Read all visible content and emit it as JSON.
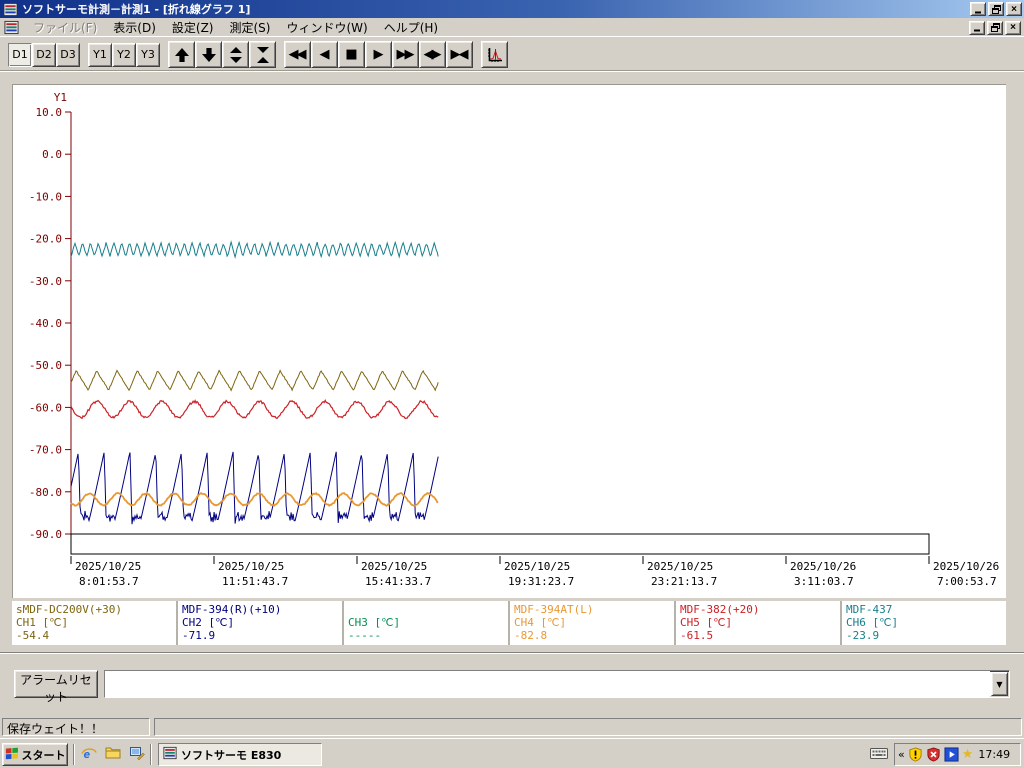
{
  "window": {
    "title": "ソフトサーモ計測－計測1 - [折れ線グラフ 1]"
  },
  "menu": {
    "items": [
      {
        "label": "ファイル(F)",
        "enabled": false
      },
      {
        "label": "表示(D)",
        "enabled": true
      },
      {
        "label": "設定(Z)",
        "enabled": true
      },
      {
        "label": "測定(S)",
        "enabled": true
      },
      {
        "label": "ウィンドウ(W)",
        "enabled": true
      },
      {
        "label": "ヘルプ(H)",
        "enabled": true
      }
    ]
  },
  "toolbar": {
    "groups": [
      {
        "buttons": [
          {
            "name": "d1",
            "label": "D1",
            "active": true
          },
          {
            "name": "d2",
            "label": "D2"
          },
          {
            "name": "d3",
            "label": "D3"
          }
        ]
      },
      {
        "buttons": [
          {
            "name": "y1",
            "label": "Y1"
          },
          {
            "name": "y2",
            "label": "Y2"
          },
          {
            "name": "y3",
            "label": "Y3"
          }
        ]
      },
      {
        "buttons": [
          {
            "name": "scroll-up",
            "icon": "arrow-up-icon"
          },
          {
            "name": "scroll-down",
            "icon": "arrow-down-icon"
          },
          {
            "name": "expand-vertical",
            "icon": "expand-vertical-icon"
          },
          {
            "name": "compress-vertical",
            "icon": "compress-vertical-icon"
          }
        ]
      },
      {
        "buttons": [
          {
            "name": "fast-rewind",
            "icon": "fast-rewind-icon"
          },
          {
            "name": "step-back",
            "icon": "step-back-icon"
          },
          {
            "name": "stop",
            "icon": "stop-icon"
          },
          {
            "name": "step-forward",
            "icon": "step-forward-icon"
          },
          {
            "name": "fast-forward",
            "icon": "fast-forward-icon"
          },
          {
            "name": "expand-horizontal",
            "icon": "expand-horizontal-icon"
          },
          {
            "name": "compress-horizontal",
            "icon": "compress-horizontal-icon"
          }
        ]
      },
      {
        "buttons": [
          {
            "name": "graph-settings",
            "icon": "chart-icon"
          }
        ]
      }
    ]
  },
  "chart_data": {
    "type": "line",
    "title": "折れ線グラフ 1",
    "grid": false,
    "y_axis": {
      "label": "Y1",
      "min": -90,
      "max": 10,
      "tick_interval": 10,
      "tick_labels": [
        "10.0",
        "0.0",
        "-10.0",
        "-20.0",
        "-30.0",
        "-40.0",
        "-50.0",
        "-60.0",
        "-70.0",
        "-80.0",
        "-90.0"
      ],
      "color": "#7d0000"
    },
    "x_axis": {
      "ticks": [
        {
          "date": "2025/10/25",
          "time": "8:01:53.7"
        },
        {
          "date": "2025/10/25",
          "time": "11:51:43.7"
        },
        {
          "date": "2025/10/25",
          "time": "15:41:33.7"
        },
        {
          "date": "2025/10/25",
          "time": "19:31:23.7"
        },
        {
          "date": "2025/10/25",
          "time": "23:21:13.7"
        },
        {
          "date": "2025/10/26",
          "time": "3:11:03.7"
        },
        {
          "date": "2025/10/26",
          "time": "7:00:53.7"
        }
      ]
    },
    "data_end_fraction": 0.428,
    "series": [
      {
        "channel": "CH1",
        "name": "sMDF-DC200V(+30)",
        "unit": "℃",
        "color": "#7d6510",
        "current": -54.4,
        "waveform": "triangle",
        "mean": -53.6,
        "amplitude": 2.3,
        "cycles": 18,
        "skew": 0.4,
        "phase": 0.15,
        "noise": 0.3,
        "stroke_width": 1
      },
      {
        "channel": "CH2",
        "name": "MDF-394(R)(+10)",
        "unit": "℃",
        "color": "#000080",
        "current": -71.9,
        "waveform": "spike",
        "min": -87,
        "max": -70.5,
        "cycles": 14.25,
        "phase": 0.31,
        "stroke_width": 1
      },
      {
        "channel": "CH3",
        "name": "",
        "unit": "℃",
        "color": "#009050",
        "current": null,
        "no_data": true
      },
      {
        "channel": "CH4",
        "name": "MDF-394AT(L)",
        "unit": "℃",
        "color": "#e89833",
        "current": -82.8,
        "waveform": "sine",
        "mean": -81.8,
        "amplitude": 1.4,
        "cycles": 13,
        "phase": 0.6,
        "noise": 0.3,
        "stroke_width": 1.8
      },
      {
        "channel": "CH5",
        "name": "MDF-382(+20)",
        "unit": "℃",
        "color": "#cc2026",
        "current": -61.5,
        "waveform": "sine",
        "mean": -60.5,
        "amplitude": 1.9,
        "cycles": 11.3,
        "phase": 0.45,
        "noise": 0.55,
        "stroke_width": 1.2
      },
      {
        "channel": "CH6",
        "name": "MDF-437",
        "unit": "℃",
        "color": "#177f8c",
        "current": -23.9,
        "waveform": "zigzag",
        "mean": -22.6,
        "amplitude": 1.6,
        "cycles": 47,
        "phase": 0,
        "noise": 0.45,
        "stroke_width": 1
      }
    ]
  },
  "legend": {
    "channels": [
      {
        "name": "sMDF-DC200V(+30)",
        "label": "CH1 [℃]",
        "value": "-54.4",
        "color": "#7d6510"
      },
      {
        "name": "MDF-394(R)(+10)",
        "label": "CH2 [℃]",
        "value": "-71.9",
        "color": "#000080"
      },
      {
        "name": "",
        "label": "CH3 [℃]",
        "value": "-----",
        "color": "#009050"
      },
      {
        "name": "MDF-394AT(L)",
        "label": "CH4 [℃]",
        "value": "-82.8",
        "color": "#e89833"
      },
      {
        "name": "MDF-382(+20)",
        "label": "CH5 [℃]",
        "value": "-61.5",
        "color": "#cc2026"
      },
      {
        "name": "MDF-437",
        "label": "CH6 [℃]",
        "value": "-23.9",
        "color": "#177f8c"
      }
    ]
  },
  "alarm": {
    "reset_label": "アラームリセット",
    "combo_value": ""
  },
  "statusbar": {
    "left": "保存ウェイト！！",
    "right": ""
  },
  "taskbar": {
    "start_label": "スタート",
    "quick_launch": [
      "ie-icon",
      "folder-icon",
      "show-desktop-icon"
    ],
    "task_label": "ソフトサーモ  E830",
    "tray_icons": [
      "security-shield-icon",
      "antivirus-shield-icon",
      "media-player-icon",
      "star-icon"
    ],
    "clock": "17:49"
  }
}
